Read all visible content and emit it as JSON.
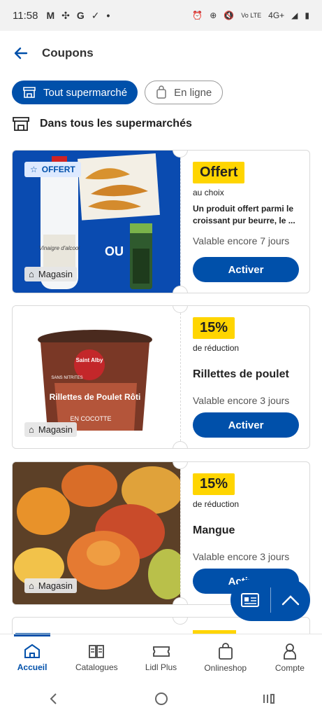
{
  "status": {
    "time": "11:58",
    "network": "4G+",
    "volte": "Vo LTE"
  },
  "appbar": {
    "title": "Coupons"
  },
  "filters": [
    {
      "label": "Tout supermarché",
      "active": true
    },
    {
      "label": "En ligne",
      "active": false
    }
  ],
  "section": {
    "title": "Dans tous les supermarchés"
  },
  "coupons": [
    {
      "offer_tag": "OFFERT",
      "ou_label": "OU",
      "badge": "Offert",
      "badge_sub": "au choix",
      "description": "Un produit offert parmi le croissant pur beurre, le ...",
      "validity": "Valable encore 7 jours",
      "button": "Activer",
      "store_tag": "Magasin",
      "pkg_brand": "Vinaigre d'alcool"
    },
    {
      "badge": "15%",
      "badge_sub": "de réduction",
      "product": "Rillettes de poulet",
      "validity": "Valable encore 3 jours",
      "button": "Activer",
      "store_tag": "Magasin",
      "pkg_brand": "Saint Alby",
      "pkg_flag": "SANS NITRITES",
      "pkg_title": "Rillettes de Poulet Rôti",
      "pkg_sub": "EN COCOTTE"
    },
    {
      "badge": "15%",
      "badge_sub": "de réduction",
      "product": "Mangue",
      "validity": "Valable encore 3 jours",
      "button": "Activer",
      "store_tag": "Magasin"
    }
  ],
  "bottom_nav": [
    {
      "label": "Accueil",
      "icon": "home-icon",
      "active": true
    },
    {
      "label": "Catalogues",
      "icon": "catalog-icon",
      "active": false
    },
    {
      "label": "Lidl Plus",
      "icon": "ticket-icon",
      "active": false
    },
    {
      "label": "Onlineshop",
      "icon": "shopping-bag-icon",
      "active": false
    },
    {
      "label": "Compte",
      "icon": "account-icon",
      "active": false
    }
  ],
  "colors": {
    "primary": "#0050aa",
    "badge": "#ffd500"
  }
}
